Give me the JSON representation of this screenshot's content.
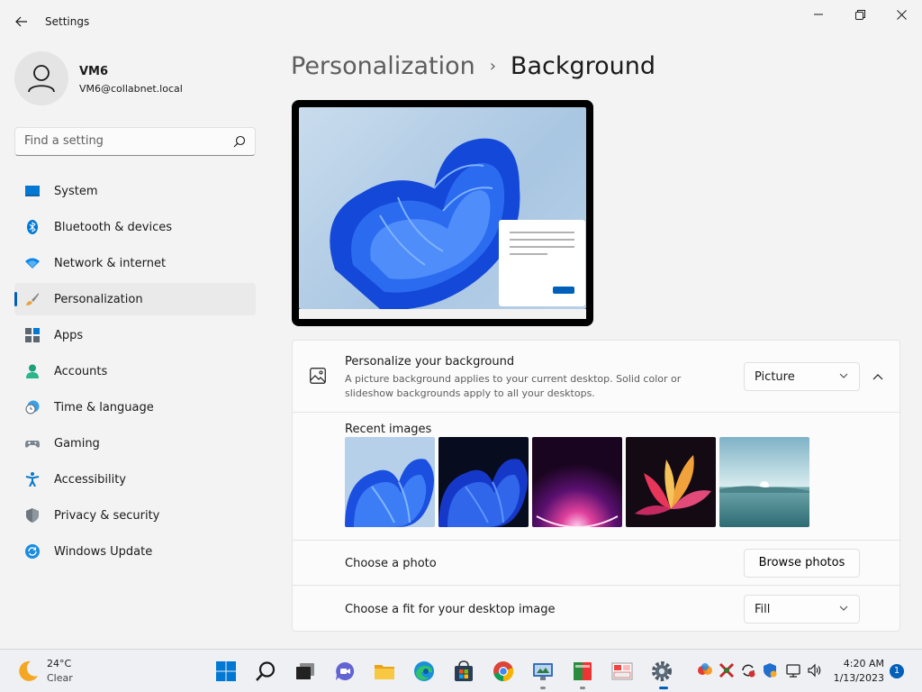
{
  "window": {
    "title": "Settings",
    "back_icon": "back-arrow-icon",
    "controls": [
      "minimize-icon",
      "maximize-icon",
      "close-icon"
    ]
  },
  "profile": {
    "name": "VM6",
    "email": "VM6@collabnet.local"
  },
  "search": {
    "placeholder": "Find a setting",
    "icon": "search-icon"
  },
  "nav": {
    "items": [
      {
        "label": "System",
        "icon": "system-icon",
        "selected": false
      },
      {
        "label": "Bluetooth & devices",
        "icon": "bluetooth-icon",
        "selected": false
      },
      {
        "label": "Network & internet",
        "icon": "wifi-icon",
        "selected": false
      },
      {
        "label": "Personalization",
        "icon": "brush-icon",
        "selected": true
      },
      {
        "label": "Apps",
        "icon": "apps-icon",
        "selected": false
      },
      {
        "label": "Accounts",
        "icon": "accounts-icon",
        "selected": false
      },
      {
        "label": "Time & language",
        "icon": "clock-globe-icon",
        "selected": false
      },
      {
        "label": "Gaming",
        "icon": "gamepad-icon",
        "selected": false
      },
      {
        "label": "Accessibility",
        "icon": "accessibility-icon",
        "selected": false
      },
      {
        "label": "Privacy & security",
        "icon": "shield-icon",
        "selected": false
      },
      {
        "label": "Windows Update",
        "icon": "update-icon",
        "selected": false
      }
    ],
    "accent": "#005fb8"
  },
  "breadcrumb": {
    "parent": "Personalization",
    "separator": "›",
    "current": "Background"
  },
  "background": {
    "title": "Personalize your background",
    "description": "A picture background applies to your current desktop. Solid color or slideshow backgrounds apply to all your desktops.",
    "type_value": "Picture",
    "recent_title": "Recent images",
    "recent_images": [
      "bloom-light-image",
      "bloom-dark-image",
      "glow-purple-image",
      "flower-image",
      "lake-image"
    ],
    "choose_photo_label": "Choose a photo",
    "browse_label": "Browse photos",
    "fit_label": "Choose a fit for your desktop image",
    "fit_value": "Fill"
  },
  "taskbar": {
    "weather_temp": "24°C",
    "weather_condition": "Clear",
    "apps": [
      "start-icon",
      "search-icon",
      "task-view-icon",
      "chat-icon",
      "file-explorer-icon",
      "edge-icon",
      "store-icon",
      "chrome-icon",
      "remote-desktop-icon",
      "app-icon",
      "paint-icon",
      "settings-gear-icon"
    ],
    "time": "4:20 AM",
    "date": "1/13/2023",
    "notification_count": "1"
  }
}
